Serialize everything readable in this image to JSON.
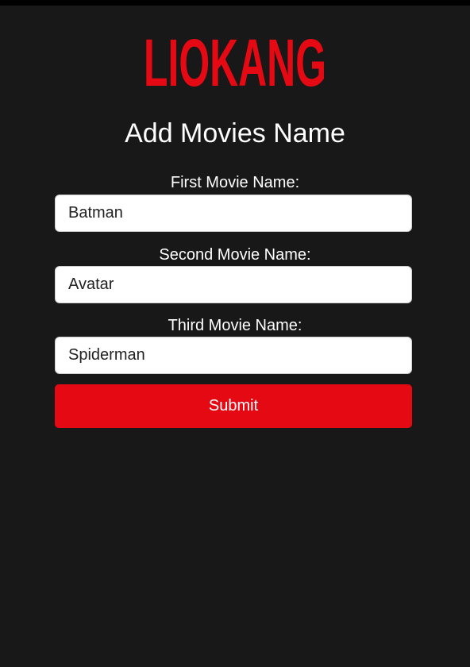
{
  "brand": {
    "logo_text": "LIOKANG",
    "color": "#e50914"
  },
  "page": {
    "title": "Add Movies Name"
  },
  "form": {
    "fields": [
      {
        "label": "First Movie Name:",
        "value": "Batman"
      },
      {
        "label": "Second Movie Name:",
        "value": "Avatar"
      },
      {
        "label": "Third Movie Name:",
        "value": "Spiderman"
      }
    ],
    "submit_label": "Submit"
  }
}
